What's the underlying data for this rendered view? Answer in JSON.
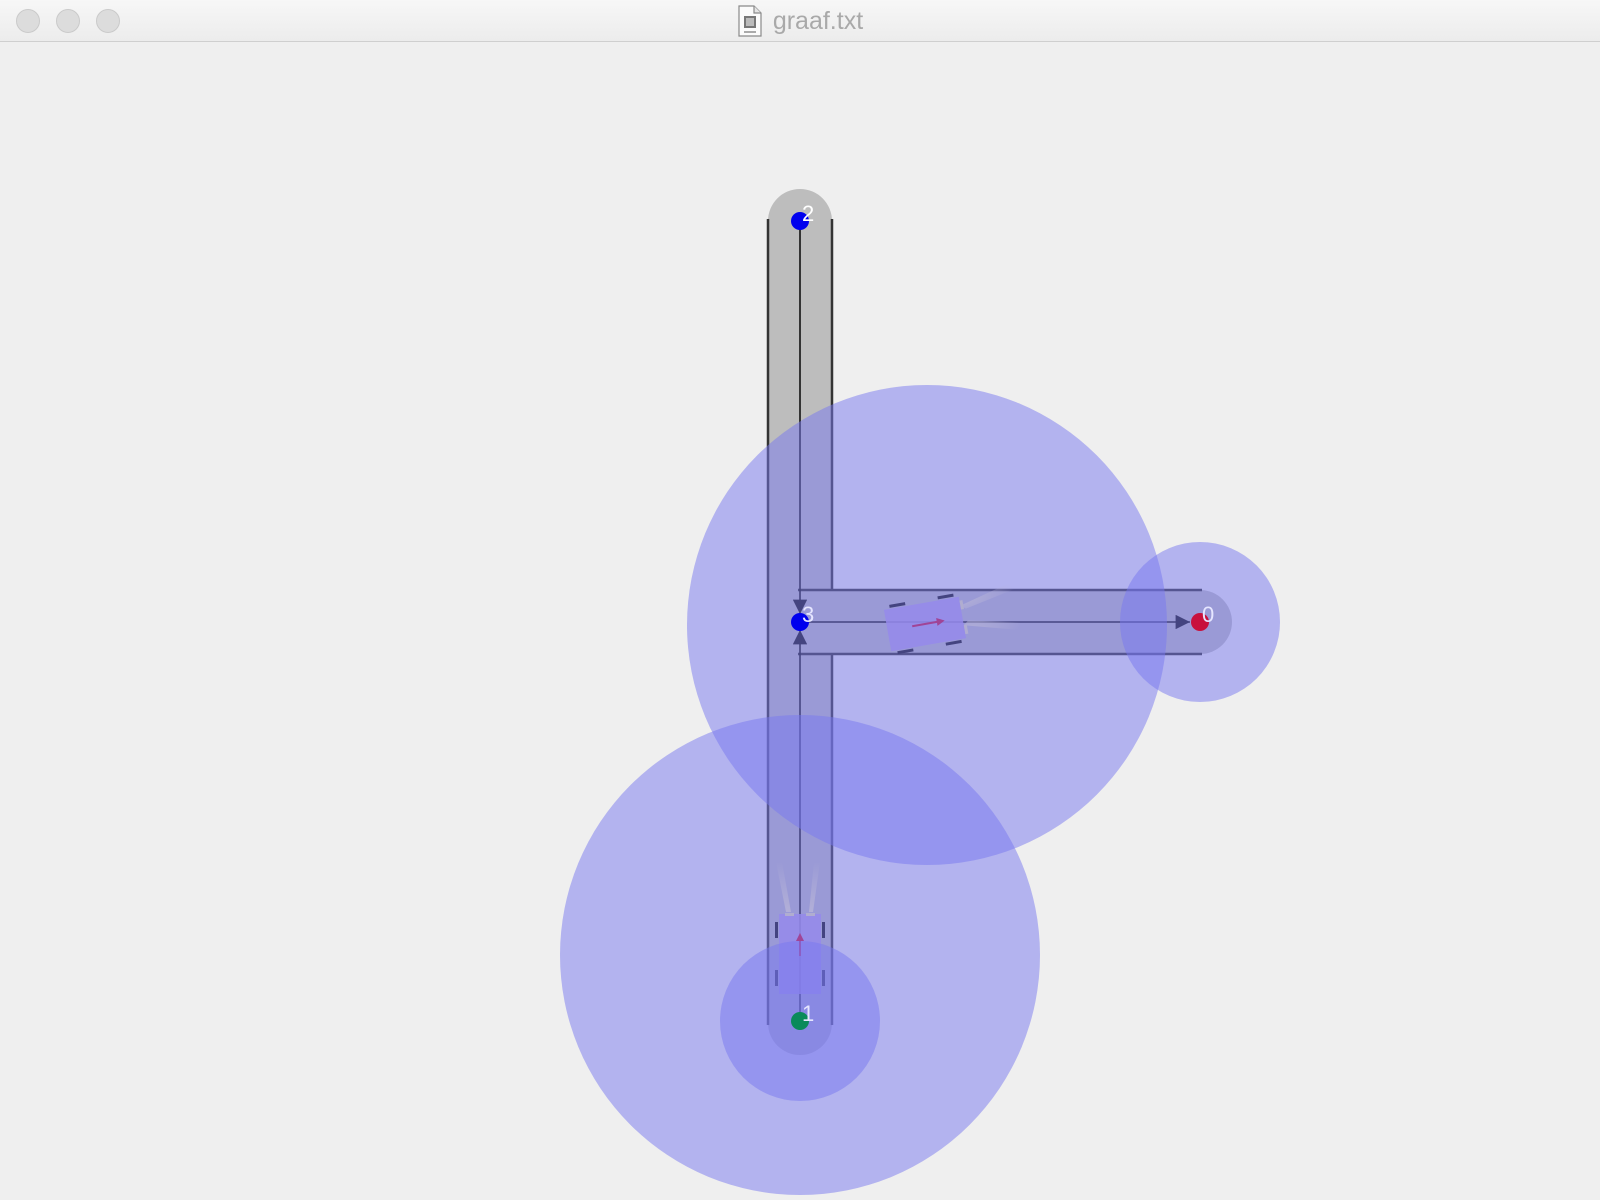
{
  "window": {
    "title": "graaf.txt",
    "title_icon": "text-document-icon",
    "controls": [
      "close-button",
      "minimize-button",
      "zoom-button"
    ]
  },
  "graph": {
    "nodes": [
      {
        "id": "0",
        "label": "0",
        "color": "#c8103c"
      },
      {
        "id": "1",
        "label": "1",
        "color": "#0a8a5a"
      },
      {
        "id": "2",
        "label": "2",
        "color": "#0000ee"
      },
      {
        "id": "3",
        "label": "3",
        "color": "#0000ee"
      }
    ],
    "edges": [
      {
        "from": "3",
        "to": "0",
        "directed": true
      },
      {
        "from": "1",
        "to": "3",
        "directed": true
      },
      {
        "from": "2",
        "to": "3",
        "directed": true
      }
    ],
    "road_color": "#bdbdbd",
    "range_color": "#7878f0",
    "vehicle_color": "#b49be6",
    "heading_arrow_color": "#c8103c"
  }
}
